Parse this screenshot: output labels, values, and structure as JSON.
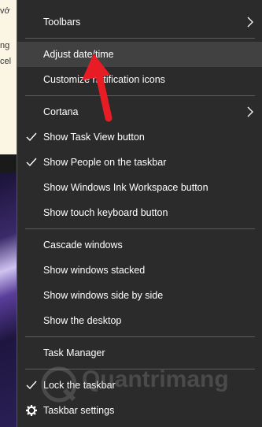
{
  "background_page": {
    "text_lines": [
      "vớ",
      "ng",
      "cel"
    ]
  },
  "menu": {
    "items": [
      {
        "label": "Toolbars",
        "has_submenu": true,
        "checked": false
      },
      {
        "label": "Adjust date/time",
        "has_submenu": false,
        "checked": false,
        "highlighted": true
      },
      {
        "label": "Customize notification icons",
        "has_submenu": false,
        "checked": false
      },
      {
        "label": "Cortana",
        "has_submenu": true,
        "checked": false
      },
      {
        "label": "Show Task View button",
        "has_submenu": false,
        "checked": true
      },
      {
        "label": "Show People on the taskbar",
        "has_submenu": false,
        "checked": true
      },
      {
        "label": "Show Windows Ink Workspace button",
        "has_submenu": false,
        "checked": false
      },
      {
        "label": "Show touch keyboard button",
        "has_submenu": false,
        "checked": false
      },
      {
        "label": "Cascade windows",
        "has_submenu": false,
        "checked": false
      },
      {
        "label": "Show windows stacked",
        "has_submenu": false,
        "checked": false
      },
      {
        "label": "Show windows side by side",
        "has_submenu": false,
        "checked": false
      },
      {
        "label": "Show the desktop",
        "has_submenu": false,
        "checked": false
      },
      {
        "label": "Task Manager",
        "has_submenu": false,
        "checked": false
      },
      {
        "label": "Lock the taskbar",
        "has_submenu": false,
        "checked": true
      },
      {
        "label": "Taskbar settings",
        "has_submenu": false,
        "checked": false,
        "icon": "gear-icon"
      }
    ]
  },
  "annotation": {
    "arrow_color": "#e81c24"
  },
  "watermark": {
    "text": "Quantrimang"
  },
  "colors": {
    "menu_bg": "#2b2b2b",
    "highlight_bg": "#414141",
    "separator": "#5c5c5c",
    "text": "#ffffff"
  }
}
